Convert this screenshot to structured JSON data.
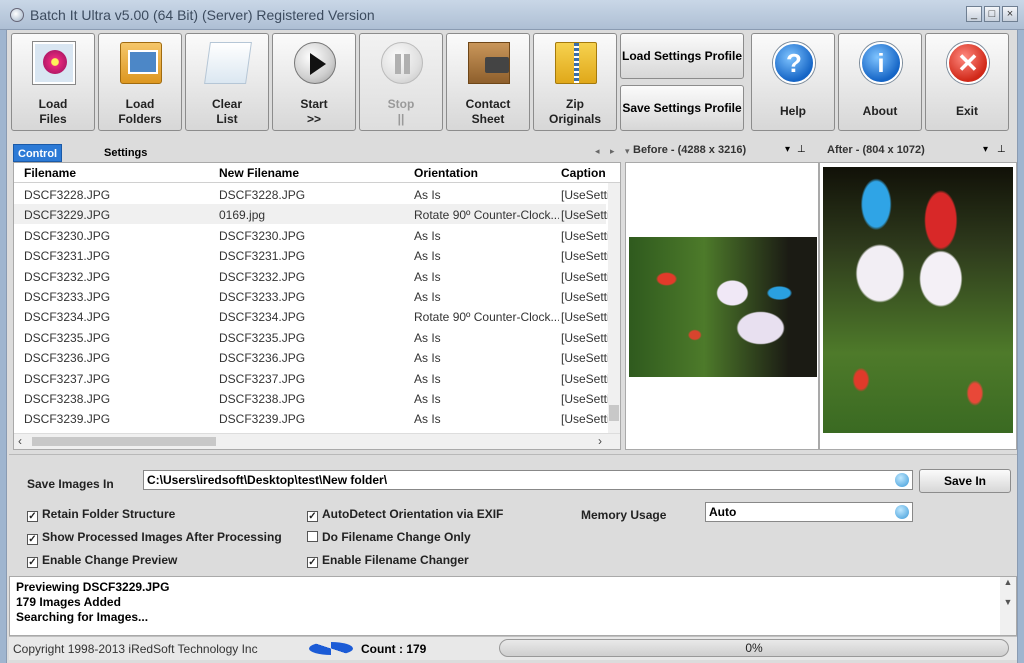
{
  "window": {
    "title": "Batch It Ultra v5.00 (64 Bit) (Server) Registered Version",
    "min": "_",
    "max": "□",
    "close": "×"
  },
  "toolbar": {
    "load_files": "Load\nFiles",
    "load_folders": "Load\nFolders",
    "clear_list": "Clear\nList",
    "start": "Start\n>>",
    "stop": "Stop\n||",
    "contact_sheet": "Contact\nSheet",
    "zip_originals": "Zip\nOriginals",
    "load_profile": "Load Settings Profile",
    "save_profile": "Save Settings Profile",
    "help": "Help",
    "about": "About",
    "exit": "Exit"
  },
  "tabs": {
    "control_center": "Control Center",
    "settings": "Settings",
    "arrows": "◂ ▸ ▾"
  },
  "grid": {
    "columns": [
      "Filename",
      "New Filename",
      "Orientation",
      "Caption"
    ],
    "rows": [
      [
        "DSCF3228.JPG",
        "DSCF3228.JPG",
        "As Is",
        "[UseSettin"
      ],
      [
        "DSCF3229.JPG",
        "0169.jpg",
        "Rotate 90º Counter-Clock...",
        "[UseSettin"
      ],
      [
        "DSCF3230.JPG",
        "DSCF3230.JPG",
        "As Is",
        "[UseSettin"
      ],
      [
        "DSCF3231.JPG",
        "DSCF3231.JPG",
        "As Is",
        "[UseSettin"
      ],
      [
        "DSCF3232.JPG",
        "DSCF3232.JPG",
        "As Is",
        "[UseSettin"
      ],
      [
        "DSCF3233.JPG",
        "DSCF3233.JPG",
        "As Is",
        "[UseSettin"
      ],
      [
        "DSCF3234.JPG",
        "DSCF3234.JPG",
        "Rotate 90º Counter-Clock...",
        "[UseSettin"
      ],
      [
        "DSCF3235.JPG",
        "DSCF3235.JPG",
        "As Is",
        "[UseSettin"
      ],
      [
        "DSCF3236.JPG",
        "DSCF3236.JPG",
        "As Is",
        "[UseSettin"
      ],
      [
        "DSCF3237.JPG",
        "DSCF3237.JPG",
        "As Is",
        "[UseSettin"
      ],
      [
        "DSCF3238.JPG",
        "DSCF3238.JPG",
        "As Is",
        "[UseSettin"
      ],
      [
        "DSCF3239.JPG",
        "DSCF3239.JPG",
        "As Is",
        "[UseSettin"
      ]
    ]
  },
  "preview": {
    "before_label": "Before - (4288 x 3216)",
    "after_label": "After - (804 x 1072)",
    "menu_glyph": "▾",
    "pin_glyph": "⊥"
  },
  "settings": {
    "save_images_in_label": "Save Images In",
    "save_path": "C:\\Users\\iredsoft\\Desktop\\test\\New folder\\",
    "save_in_button": "Save In",
    "memory_usage_label": "Memory Usage",
    "memory_usage_value": "Auto",
    "checkboxes": {
      "retain_folder": {
        "label": "Retain Folder Structure",
        "checked": true
      },
      "show_processed": {
        "label": "Show Processed Images After Processing",
        "checked": true
      },
      "enable_preview": {
        "label": "Enable Change Preview",
        "checked": true
      },
      "autodetect_orientation": {
        "label": "AutoDetect Orientation via EXIF",
        "checked": true
      },
      "filename_only": {
        "label": "Do Filename Change Only",
        "checked": false
      },
      "filename_changer": {
        "label": "Enable Filename Changer",
        "checked": true
      }
    }
  },
  "log": {
    "lines": [
      "Previewing DSCF3229.JPG",
      "179 Images Added",
      "Searching for Images..."
    ]
  },
  "status": {
    "copyright": "Copyright 1998-2013 iRedSoft Technology Inc",
    "count": "Count : 179",
    "progress_text": "0%",
    "progress_value": 0
  },
  "colors": {
    "tab_active": "#2c7ad6",
    "progress_fill": "#2c7ad6"
  }
}
